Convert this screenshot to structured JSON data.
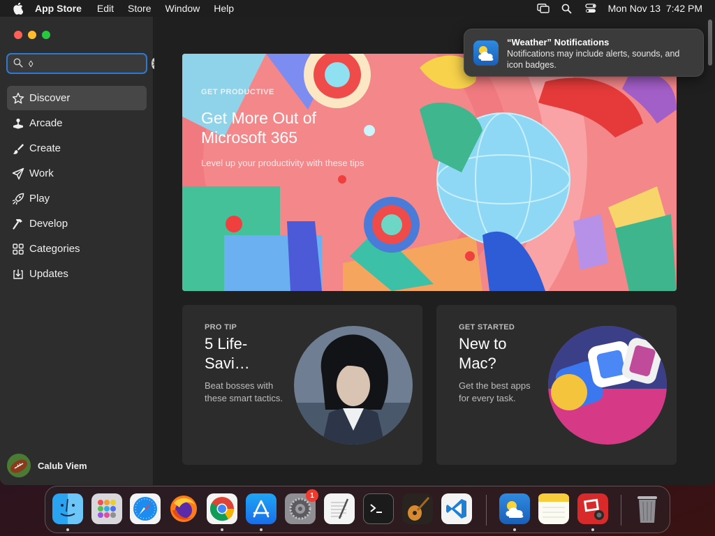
{
  "menubar": {
    "app_name": "App Store",
    "menus": [
      "Edit",
      "Store",
      "Window",
      "Help"
    ],
    "datetime": "Mon Nov 13  7:42 PM"
  },
  "search": {
    "value": "◊",
    "placeholder": ""
  },
  "sidebar": {
    "items": [
      {
        "label": "Discover",
        "icon": "star-icon"
      },
      {
        "label": "Arcade",
        "icon": "joystick-icon"
      },
      {
        "label": "Create",
        "icon": "paintbrush-icon"
      },
      {
        "label": "Work",
        "icon": "paperplane-icon"
      },
      {
        "label": "Play",
        "icon": "rocket-icon"
      },
      {
        "label": "Develop",
        "icon": "hammer-icon"
      },
      {
        "label": "Categories",
        "icon": "grid-icon"
      },
      {
        "label": "Updates",
        "icon": "download-icon"
      }
    ],
    "user_name": "Calub Viem"
  },
  "hero": {
    "eyebrow": "GET PRODUCTIVE",
    "title": "Get More Out of Microsoft 365",
    "subtitle": "Level up your productivity with these tips"
  },
  "cards": [
    {
      "eyebrow": "PRO TIP",
      "title": "5 Life-Savi…",
      "body": "Beat bosses with these smart tactics."
    },
    {
      "eyebrow": "GET STARTED",
      "title": "New to Mac?",
      "body": "Get the best apps for every task."
    }
  ],
  "notification": {
    "title": "“Weather” Notifications",
    "body": "Notifications may include alerts, sounds, and icon badges."
  },
  "dock": {
    "apps": [
      "finder-icon",
      "launchpad-icon",
      "safari-icon",
      "firefox-icon",
      "chrome-icon",
      "app-store-icon",
      "system-settings-icon",
      "textedit-icon",
      "terminal-icon",
      "garageband-icon",
      "vscode-icon",
      "weather-icon",
      "notes-icon",
      "photo-booth-icon",
      "trash-icon"
    ],
    "settings_badge": "1"
  },
  "colors": {
    "accent": "#2d7ad4",
    "traffic_red": "#fe5f57",
    "traffic_yellow": "#febc2e",
    "traffic_green": "#28c840",
    "badge": "#f03a2e"
  }
}
